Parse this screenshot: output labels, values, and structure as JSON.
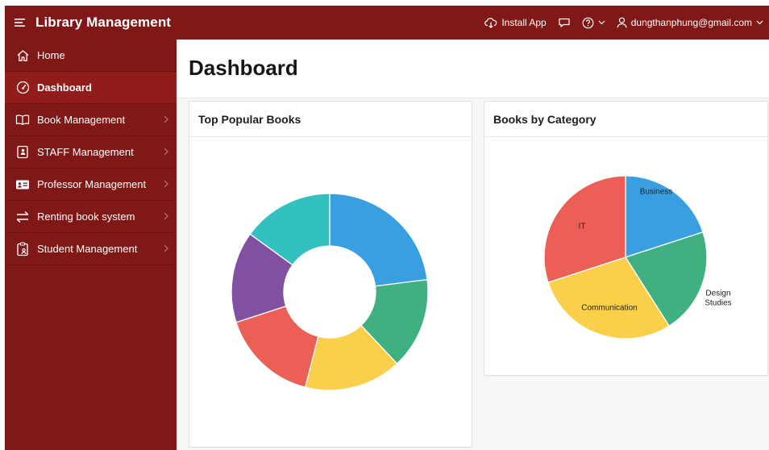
{
  "app": {
    "title": "Library Management"
  },
  "header": {
    "install_label": "Install App",
    "user_email": "dungthanphung@gmail.com"
  },
  "sidebar": {
    "items": [
      {
        "label": "Home",
        "icon": "home-icon",
        "has_children": false,
        "active": false
      },
      {
        "label": "Dashboard",
        "icon": "gauge-icon",
        "has_children": false,
        "active": true
      },
      {
        "label": "Book Management",
        "icon": "book-icon",
        "has_children": true,
        "active": false
      },
      {
        "label": "STAFF Management",
        "icon": "contact-book-icon",
        "has_children": true,
        "active": false
      },
      {
        "label": "Professor Management",
        "icon": "id-card-icon",
        "has_children": true,
        "active": false
      },
      {
        "label": "Renting book system",
        "icon": "swap-arrows-icon",
        "has_children": true,
        "active": false
      },
      {
        "label": "Student Management",
        "icon": "clipboard-user-icon",
        "has_children": true,
        "active": false
      }
    ]
  },
  "page": {
    "title": "Dashboard"
  },
  "colors": {
    "topbar": "#811818",
    "sidebar": "#801818",
    "sidebar_active": "#901c1c",
    "blue": "#3a9fe0",
    "green": "#40b080",
    "yellow": "#fad04a",
    "red": "#eb5f57",
    "purple": "#8150a0",
    "teal": "#33c1bf"
  },
  "chart_data": [
    {
      "type": "pie",
      "variant": "donut",
      "title": "Top Popular Books",
      "slices": [
        {
          "label": "",
          "value": 23,
          "color": "#3a9fe0"
        },
        {
          "label": "",
          "value": 15,
          "color": "#40b080"
        },
        {
          "label": "",
          "value": 16,
          "color": "#fad04a"
        },
        {
          "label": "",
          "value": 16,
          "color": "#eb5f57"
        },
        {
          "label": "",
          "value": 15,
          "color": "#8150a0"
        },
        {
          "label": "",
          "value": 15,
          "color": "#33c1bf"
        }
      ]
    },
    {
      "type": "pie",
      "title": "Books by Category",
      "slices": [
        {
          "label": "Business",
          "value": 20,
          "color": "#3a9fe0"
        },
        {
          "label": "Design Studies",
          "value": 21,
          "color": "#40b080"
        },
        {
          "label": "Communication",
          "value": 29,
          "color": "#fad04a"
        },
        {
          "label": "IT",
          "value": 30,
          "color": "#eb5f57"
        }
      ]
    }
  ]
}
